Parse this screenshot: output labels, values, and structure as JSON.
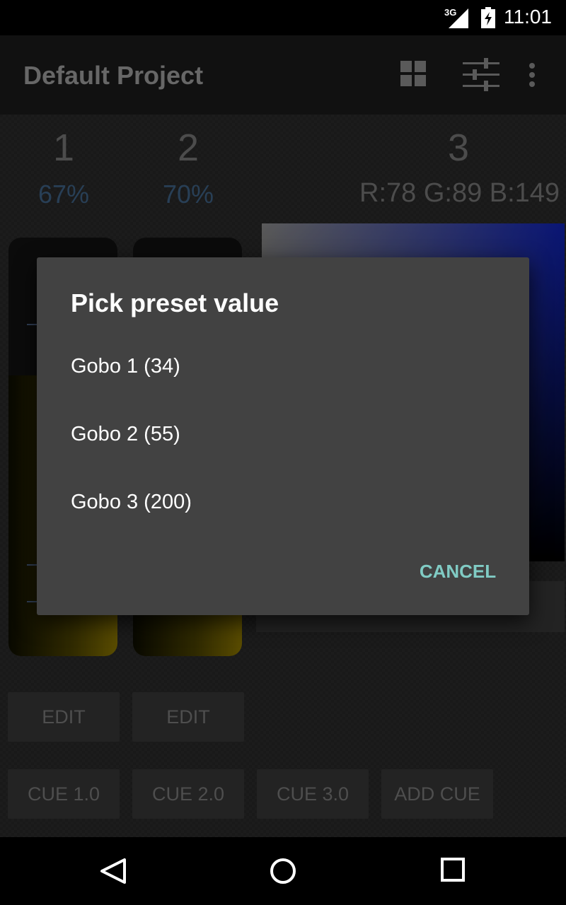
{
  "status_bar": {
    "network": "3G",
    "time": "11:01"
  },
  "app_bar": {
    "title": "Default Project",
    "icons": [
      "grid-view-icon",
      "sliders-icon",
      "overflow-menu-icon"
    ]
  },
  "channels": [
    {
      "number": "1",
      "value": "67%"
    },
    {
      "number": "2",
      "value": "70%"
    },
    {
      "number": "3",
      "value": "R:78 G:89 B:149"
    }
  ],
  "faders": [
    {
      "level": 0.67
    },
    {
      "level": 0.7
    }
  ],
  "edit_buttons": [
    {
      "label": "EDIT"
    },
    {
      "label": "EDIT"
    }
  ],
  "cue_buttons": [
    {
      "label": "CUE 1.0"
    },
    {
      "label": "CUE 2.0"
    },
    {
      "label": "CUE 3.0"
    },
    {
      "label": "ADD CUE"
    }
  ],
  "dialog": {
    "title": "Pick preset value",
    "items": [
      {
        "label": "Gobo 1 (34)"
      },
      {
        "label": "Gobo 2 (55)"
      },
      {
        "label": "Gobo 3 (200)"
      }
    ],
    "cancel_label": "CANCEL"
  },
  "colors": {
    "accent": "#80cbc4",
    "dialog_bg": "#424242",
    "channel_value": "#2f4a66"
  },
  "nav_bar": {
    "icons": [
      "back-icon",
      "home-icon",
      "recents-icon"
    ]
  }
}
